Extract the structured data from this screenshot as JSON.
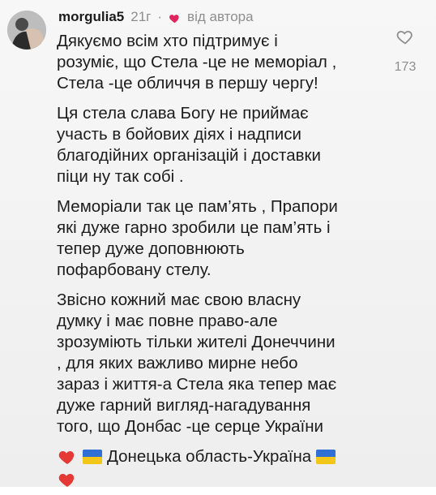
{
  "comment": {
    "username": "morgulia5",
    "time": "21г",
    "separator": "·",
    "author_like_label": "від автора",
    "like_count": "173",
    "paragraphs": [
      {
        "lines": [
          "Дякуємо всім хто підтримує і",
          "розуміє, що Стела -це не меморіал ,",
          "Стела -це обличчя в першу чергу!"
        ]
      },
      {
        "lines": [
          "Ця стела слава Богу не приймає",
          "участь в бойових діях і надписи",
          "благодійних організацій і доставки",
          "піци ну так собі ."
        ]
      },
      {
        "lines": [
          "Меморіали так це пам’ять , Прапори",
          "які дуже гарно зробили це пам’ять і",
          "тепер дуже доповнюють",
          "пофарбовану стелу."
        ]
      },
      {
        "lines": [
          "Звісно кожний має свою власну",
          "думку і має повне право-але",
          "зрозуміють тільки жителі Донеччини",
          ", для яких важливо мирне небо",
          "зараз і життя-а Стела яка тепер має",
          "дуже гарний вигляд-нагадування",
          "того, що Донбас -це серце України"
        ]
      }
    ],
    "final_text": "Донецька область-Україна"
  },
  "colors": {
    "muted": "#8e8e8e",
    "text": "#1c1c1c",
    "heart": "#e0245e",
    "flag_blue": "#2f6fd6",
    "flag_yellow": "#f3c61a"
  },
  "icons": {
    "avatar": "avatar",
    "author_heart": "heart-icon",
    "like": "heart-outline-icon",
    "emoji_heart": "red-heart-emoji-icon",
    "flag": "ukraine-flag-emoji-icon"
  }
}
